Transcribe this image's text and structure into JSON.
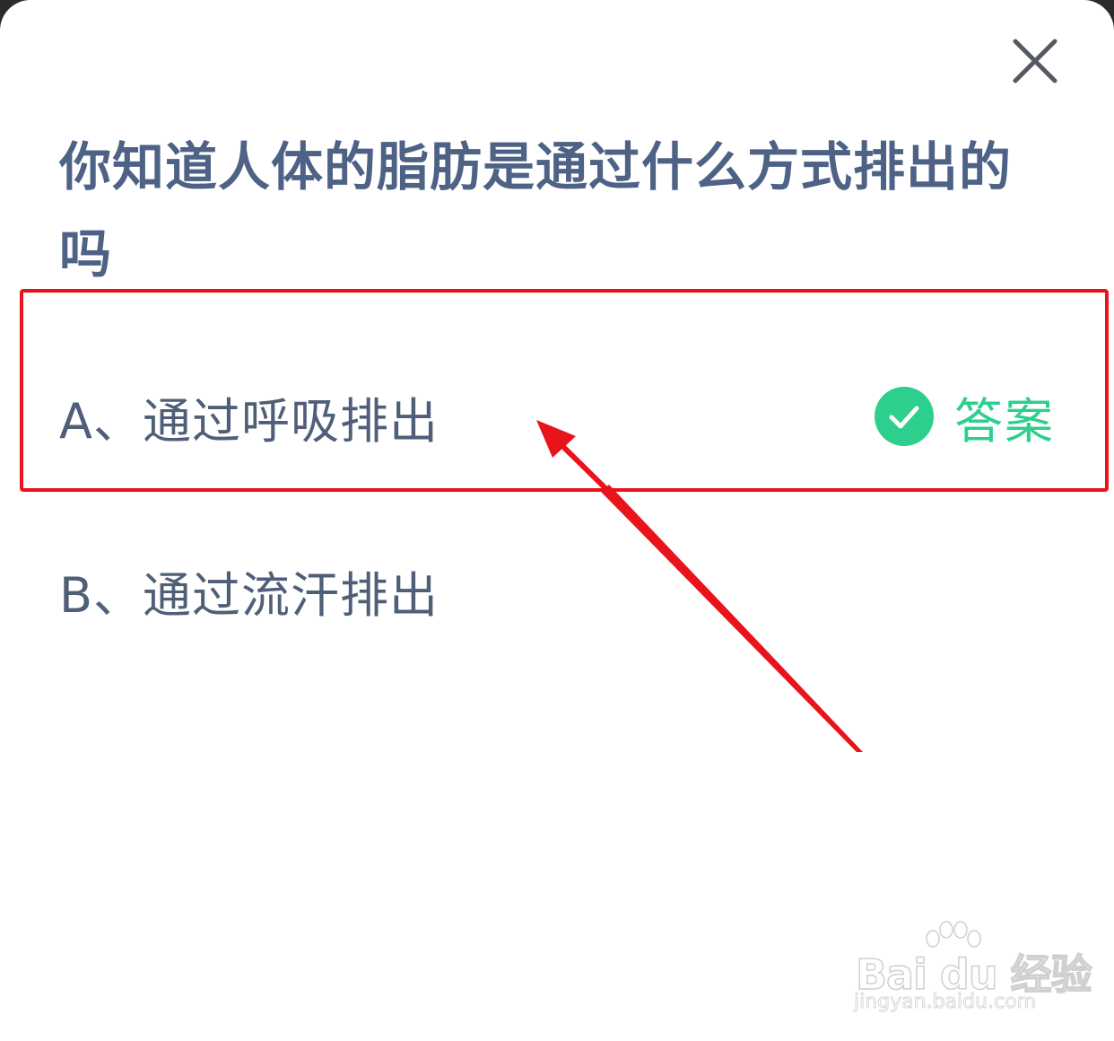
{
  "dialog": {
    "question": "你知道人体的脂肪是通过什么方式排出的吗",
    "options": [
      {
        "label": "A、通过呼吸排出",
        "is_answer": true
      },
      {
        "label": "B、通过流汗排出",
        "is_answer": false
      }
    ],
    "answer_tag": {
      "label": "答案",
      "icon": "check-circle-icon",
      "color": "#2ccf8c"
    },
    "close_icon": "close-icon"
  },
  "annotation": {
    "highlight_color": "#e8131b"
  },
  "watermark": {
    "logo": "Bai du 经验",
    "url": "jingyan.baidu.com"
  },
  "colors": {
    "question_text": "#4d6285",
    "option_text": "#4f5f78",
    "background": "#ffffff"
  }
}
